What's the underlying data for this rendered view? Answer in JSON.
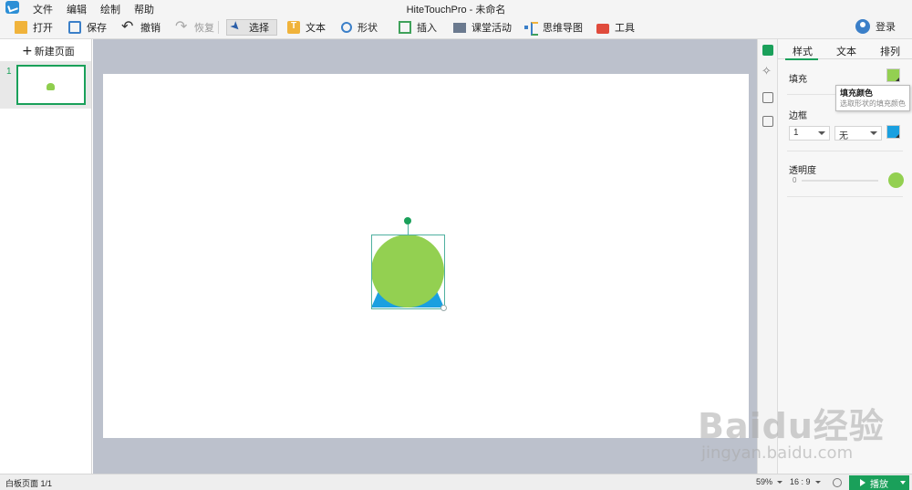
{
  "window": {
    "title": "HiteTouchPro - 未命名"
  },
  "menu": [
    "文件",
    "编辑",
    "绘制",
    "帮助"
  ],
  "toolbar": {
    "open": "打开",
    "save": "保存",
    "undo": "撤销",
    "redo": "恢复",
    "select": "选择",
    "text": "文本",
    "shape": "形状",
    "insert": "插入",
    "class_activity": "课堂活动",
    "mind_map": "思维导图",
    "tools": "工具",
    "login": "登录"
  },
  "pages_panel": {
    "new_page": "新建页面",
    "pages": [
      {
        "number": "1"
      }
    ]
  },
  "properties": {
    "tabs": [
      "样式",
      "文本",
      "排列"
    ],
    "fill_label": "填充",
    "fill_color": "#93d051",
    "border_label": "边框",
    "border_width": "1",
    "border_style": "无",
    "border_color": "#1aa0e0",
    "opacity_label": "透明度",
    "opacity_value": "0",
    "tooltip_title": "填充颜色",
    "tooltip_desc": "选取形状的填充颜色"
  },
  "canvas": {
    "shapes": [
      {
        "type": "circle",
        "color": "#93d051"
      },
      {
        "type": "trapezoid",
        "color": "#1aa0e0"
      }
    ]
  },
  "status": {
    "page_info": "白板页面 1/1",
    "zoom": "59%",
    "ratio": "16 : 9",
    "present": "播放"
  },
  "watermark": {
    "brand": "Baidu经验",
    "url": "jingyan.baidu.com"
  }
}
